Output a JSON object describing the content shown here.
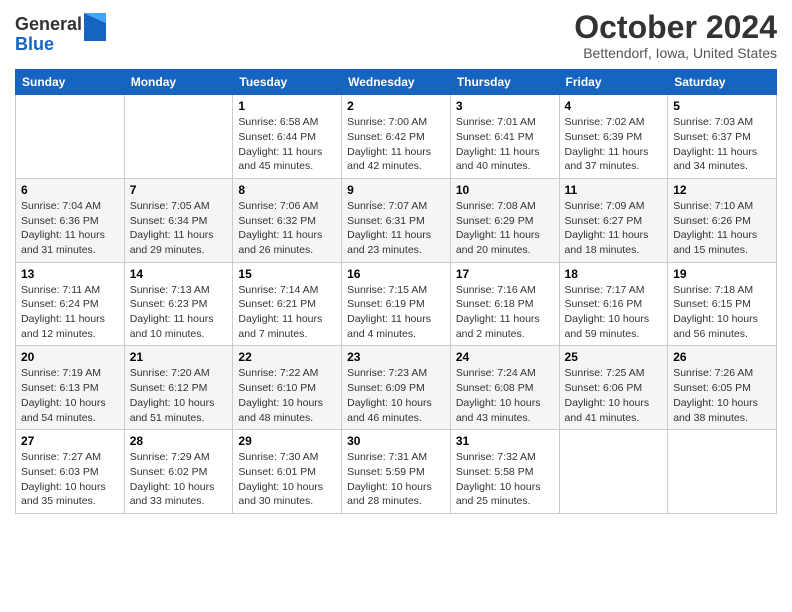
{
  "logo": {
    "general": "General",
    "blue": "Blue"
  },
  "title": "October 2024",
  "location": "Bettendorf, Iowa, United States",
  "days_of_week": [
    "Sunday",
    "Monday",
    "Tuesday",
    "Wednesday",
    "Thursday",
    "Friday",
    "Saturday"
  ],
  "weeks": [
    [
      {
        "day": null,
        "info": null
      },
      {
        "day": null,
        "info": null
      },
      {
        "day": "1",
        "info": "Sunrise: 6:58 AM\nSunset: 6:44 PM\nDaylight: 11 hours and 45 minutes."
      },
      {
        "day": "2",
        "info": "Sunrise: 7:00 AM\nSunset: 6:42 PM\nDaylight: 11 hours and 42 minutes."
      },
      {
        "day": "3",
        "info": "Sunrise: 7:01 AM\nSunset: 6:41 PM\nDaylight: 11 hours and 40 minutes."
      },
      {
        "day": "4",
        "info": "Sunrise: 7:02 AM\nSunset: 6:39 PM\nDaylight: 11 hours and 37 minutes."
      },
      {
        "day": "5",
        "info": "Sunrise: 7:03 AM\nSunset: 6:37 PM\nDaylight: 11 hours and 34 minutes."
      }
    ],
    [
      {
        "day": "6",
        "info": "Sunrise: 7:04 AM\nSunset: 6:36 PM\nDaylight: 11 hours and 31 minutes."
      },
      {
        "day": "7",
        "info": "Sunrise: 7:05 AM\nSunset: 6:34 PM\nDaylight: 11 hours and 29 minutes."
      },
      {
        "day": "8",
        "info": "Sunrise: 7:06 AM\nSunset: 6:32 PM\nDaylight: 11 hours and 26 minutes."
      },
      {
        "day": "9",
        "info": "Sunrise: 7:07 AM\nSunset: 6:31 PM\nDaylight: 11 hours and 23 minutes."
      },
      {
        "day": "10",
        "info": "Sunrise: 7:08 AM\nSunset: 6:29 PM\nDaylight: 11 hours and 20 minutes."
      },
      {
        "day": "11",
        "info": "Sunrise: 7:09 AM\nSunset: 6:27 PM\nDaylight: 11 hours and 18 minutes."
      },
      {
        "day": "12",
        "info": "Sunrise: 7:10 AM\nSunset: 6:26 PM\nDaylight: 11 hours and 15 minutes."
      }
    ],
    [
      {
        "day": "13",
        "info": "Sunrise: 7:11 AM\nSunset: 6:24 PM\nDaylight: 11 hours and 12 minutes."
      },
      {
        "day": "14",
        "info": "Sunrise: 7:13 AM\nSunset: 6:23 PM\nDaylight: 11 hours and 10 minutes."
      },
      {
        "day": "15",
        "info": "Sunrise: 7:14 AM\nSunset: 6:21 PM\nDaylight: 11 hours and 7 minutes."
      },
      {
        "day": "16",
        "info": "Sunrise: 7:15 AM\nSunset: 6:19 PM\nDaylight: 11 hours and 4 minutes."
      },
      {
        "day": "17",
        "info": "Sunrise: 7:16 AM\nSunset: 6:18 PM\nDaylight: 11 hours and 2 minutes."
      },
      {
        "day": "18",
        "info": "Sunrise: 7:17 AM\nSunset: 6:16 PM\nDaylight: 10 hours and 59 minutes."
      },
      {
        "day": "19",
        "info": "Sunrise: 7:18 AM\nSunset: 6:15 PM\nDaylight: 10 hours and 56 minutes."
      }
    ],
    [
      {
        "day": "20",
        "info": "Sunrise: 7:19 AM\nSunset: 6:13 PM\nDaylight: 10 hours and 54 minutes."
      },
      {
        "day": "21",
        "info": "Sunrise: 7:20 AM\nSunset: 6:12 PM\nDaylight: 10 hours and 51 minutes."
      },
      {
        "day": "22",
        "info": "Sunrise: 7:22 AM\nSunset: 6:10 PM\nDaylight: 10 hours and 48 minutes."
      },
      {
        "day": "23",
        "info": "Sunrise: 7:23 AM\nSunset: 6:09 PM\nDaylight: 10 hours and 46 minutes."
      },
      {
        "day": "24",
        "info": "Sunrise: 7:24 AM\nSunset: 6:08 PM\nDaylight: 10 hours and 43 minutes."
      },
      {
        "day": "25",
        "info": "Sunrise: 7:25 AM\nSunset: 6:06 PM\nDaylight: 10 hours and 41 minutes."
      },
      {
        "day": "26",
        "info": "Sunrise: 7:26 AM\nSunset: 6:05 PM\nDaylight: 10 hours and 38 minutes."
      }
    ],
    [
      {
        "day": "27",
        "info": "Sunrise: 7:27 AM\nSunset: 6:03 PM\nDaylight: 10 hours and 35 minutes."
      },
      {
        "day": "28",
        "info": "Sunrise: 7:29 AM\nSunset: 6:02 PM\nDaylight: 10 hours and 33 minutes."
      },
      {
        "day": "29",
        "info": "Sunrise: 7:30 AM\nSunset: 6:01 PM\nDaylight: 10 hours and 30 minutes."
      },
      {
        "day": "30",
        "info": "Sunrise: 7:31 AM\nSunset: 5:59 PM\nDaylight: 10 hours and 28 minutes."
      },
      {
        "day": "31",
        "info": "Sunrise: 7:32 AM\nSunset: 5:58 PM\nDaylight: 10 hours and 25 minutes."
      },
      {
        "day": null,
        "info": null
      },
      {
        "day": null,
        "info": null
      }
    ]
  ]
}
